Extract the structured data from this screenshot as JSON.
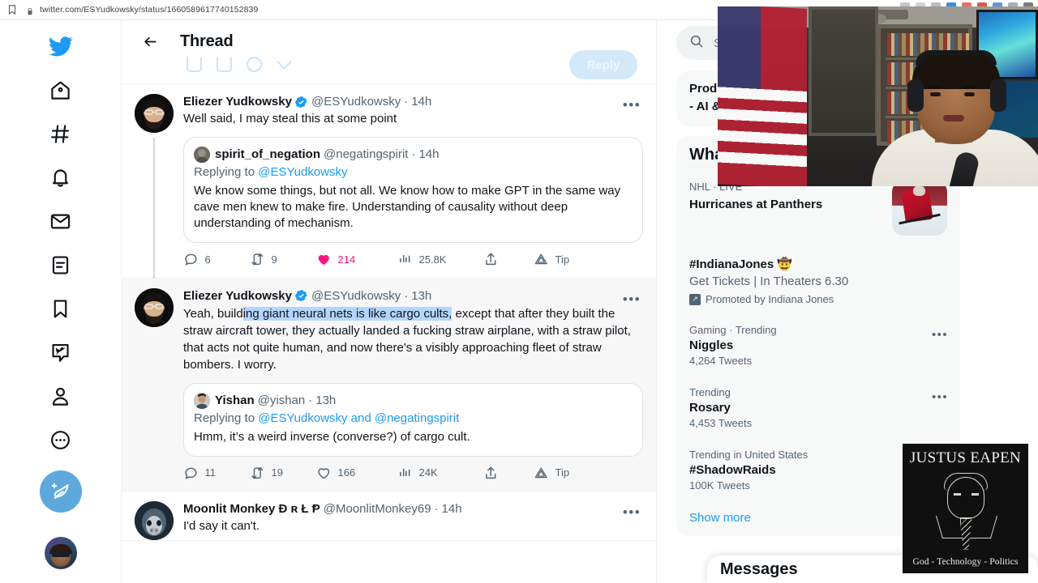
{
  "browser": {
    "url": "twitter.com/ESYudkowsky/status/1660589617740152839",
    "bookmark_icon": "bookmark-icon",
    "lock_icon": "lock-icon"
  },
  "leftnav": {
    "items": [
      {
        "name": "twitter-logo",
        "label": "Twitter"
      },
      {
        "name": "home",
        "label": "Home"
      },
      {
        "name": "explore",
        "label": "Explore"
      },
      {
        "name": "notifications",
        "label": "Notifications"
      },
      {
        "name": "messages",
        "label": "Messages"
      },
      {
        "name": "lists",
        "label": "Lists"
      },
      {
        "name": "bookmarks",
        "label": "Bookmarks"
      },
      {
        "name": "twitter-blue",
        "label": "Twitter Blue"
      },
      {
        "name": "profile",
        "label": "Profile"
      },
      {
        "name": "more",
        "label": "More"
      }
    ],
    "compose_label": "Tweet"
  },
  "header": {
    "title": "Thread",
    "back_label": "Back",
    "reply_button_label": "Reply"
  },
  "tweets": [
    {
      "display_name": "Eliezer Yudkowsky",
      "verified": true,
      "handle": "@ESYudkowsky",
      "time": "14h",
      "text": "Well said, I may steal this at some point",
      "quote": {
        "display_name": "spirit_of_negation",
        "handle": "@negatingspirit",
        "time": "14h",
        "replying_to": "Replying to ",
        "replying_to_handles": "@ESYudkowsky",
        "text": "We know some things, but not all. We know how to make GPT in the same way cave men knew to make fire. Understanding of causality without deep understanding of mechanism."
      },
      "actions": {
        "replies": "6",
        "retweets": "9",
        "likes": "214",
        "liked": true,
        "views": "25.8K",
        "tip_label": "Tip"
      }
    },
    {
      "display_name": "Eliezer Yudkowsky",
      "verified": true,
      "handle": "@ESYudkowsky",
      "time": "13h",
      "text_before": "Yeah, build",
      "text_selected": "ing giant neural nets is like cargo cults,",
      "text_after": " except that after they built the straw aircraft tower, they actually landed a fucking straw airplane, with a straw pilot, that acts not quite human, and now there's a visibly approaching fleet of straw bombers.  I worry.",
      "quote": {
        "display_name": "Yishan",
        "handle": "@yishan",
        "time": "13h",
        "replying_to": "Replying to ",
        "replying_to_handles": "@ESYudkowsky and @negatingspirit",
        "text": "Hmm, it’s a weird inverse (converse?) of cargo cult."
      },
      "actions": {
        "replies": "11",
        "retweets": "19",
        "likes": "166",
        "liked": false,
        "views": "24K",
        "tip_label": "Tip"
      }
    },
    {
      "display_name": "Moonlit Monkey Ð ʀ Ł Ᵽ",
      "verified": false,
      "handle": "@MoonlitMonkey69",
      "time": "14h",
      "text": "I'd say it can't."
    }
  ],
  "right": {
    "search_placeholder": "Search Twitter",
    "search_value": "",
    "search_icon": "search-icon",
    "top_panel": {
      "line1": "Produ",
      "line2": "- AI &"
    },
    "whats_happening_title": "Wha",
    "nhl": {
      "category": "NHL · LIVE",
      "title": "Hurricanes at Panthers"
    },
    "promoted": {
      "hashtag": "#IndianaJones 🤠",
      "subtitle": "Get Tickets | In Theaters 6.30",
      "promoted_by": "Promoted by Indiana Jones"
    },
    "trends": [
      {
        "category": "Gaming · Trending",
        "name": "Niggles",
        "count": "4,264 Tweets"
      },
      {
        "category": "Trending",
        "name": "Rosary",
        "count": "4,453 Tweets"
      },
      {
        "category": "Trending in United States",
        "name": "#ShadowRaids",
        "count": "100K Tweets"
      }
    ],
    "show_more": "Show more"
  },
  "overlays": {
    "justus": {
      "title": "JUSTUS EAPEN",
      "subtitle": "God - Technology - Politics"
    },
    "messages_dock": {
      "title": "Messages",
      "compose_icon": "new-message-icon",
      "expand_icon": "chevron-up-icon"
    }
  },
  "colors": {
    "twitter_blue": "#1d9bf0",
    "like_pink": "#f91880",
    "selection_blue": "#b4d5fe",
    "text_primary": "#0f1419",
    "text_secondary": "#536471"
  }
}
